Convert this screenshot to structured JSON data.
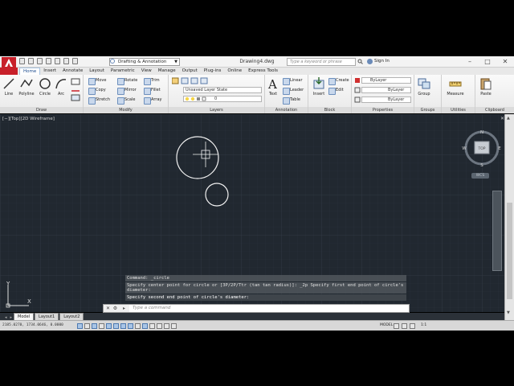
{
  "titlebar": {
    "workspace": "Drafting & Annotation",
    "doc_title": "Drawing4.dwg",
    "search_placeholder": "Type a keyword or phrase",
    "signin": "Sign In",
    "minimize": "–",
    "maximize": "□",
    "close": "✕"
  },
  "ribbon_tabs": [
    "Home",
    "Insert",
    "Annotate",
    "Layout",
    "Parametric",
    "View",
    "Manage",
    "Output",
    "Plug-ins",
    "Online",
    "Express Tools"
  ],
  "draw_panel": {
    "title": "Draw",
    "tools": [
      "Line",
      "Polyline",
      "Circle",
      "Arc"
    ]
  },
  "modify_panel": {
    "title": "Modify",
    "tools": [
      "Move",
      "Rotate",
      "Trim",
      "Copy",
      "Mirror",
      "Fillet",
      "Stretch",
      "Scale",
      "Array"
    ]
  },
  "layers_panel": {
    "title": "Layers",
    "layer_state": "Unsaved Layer State",
    "current_layer": "0"
  },
  "annotation_panel": {
    "title": "Annotation",
    "text": "Text",
    "linear": "Linear",
    "leader": "Leader",
    "table": "Table"
  },
  "block_panel": {
    "title": "Block",
    "insert": "Insert",
    "create": "Create",
    "edit": "Edit"
  },
  "properties_panel": {
    "title": "Properties",
    "color": "ByLayer",
    "linetype": "ByLayer",
    "lineweight": "ByLayer"
  },
  "groups_panel": {
    "title": "Groups",
    "group": "Group"
  },
  "utilities_panel": {
    "title": "Utilities",
    "measure": "Measure"
  },
  "clipboard_panel": {
    "title": "Clipboard",
    "paste": "Paste"
  },
  "viewport": {
    "label": "[−][Top][2D Wireframe]",
    "close": "✕",
    "viewcube": {
      "top": "TOP",
      "n": "N",
      "s": "S",
      "e": "E",
      "w": "W"
    },
    "wcs": "WCS"
  },
  "command_history": [
    "Command: _circle",
    "Specify center point for circle or [3P/2P/Ttr (tan tan radius)]: _2p Specify first end point of circle's diameter:",
    "Specify second end point of circle's diameter:"
  ],
  "command_input": {
    "placeholder": "Type a command"
  },
  "ucs": {
    "x": "X",
    "y": "Y"
  },
  "layout_tabs": [
    "Model",
    "Layout1",
    "Layout2"
  ],
  "statusbar": {
    "coords": "2185.0270, 1734.0646, 0.0000",
    "model": "MODEL",
    "scale": "1:1"
  },
  "colors": {
    "canvas": "#212830",
    "accent": "#c8202a",
    "ribbon": "#ececec"
  }
}
